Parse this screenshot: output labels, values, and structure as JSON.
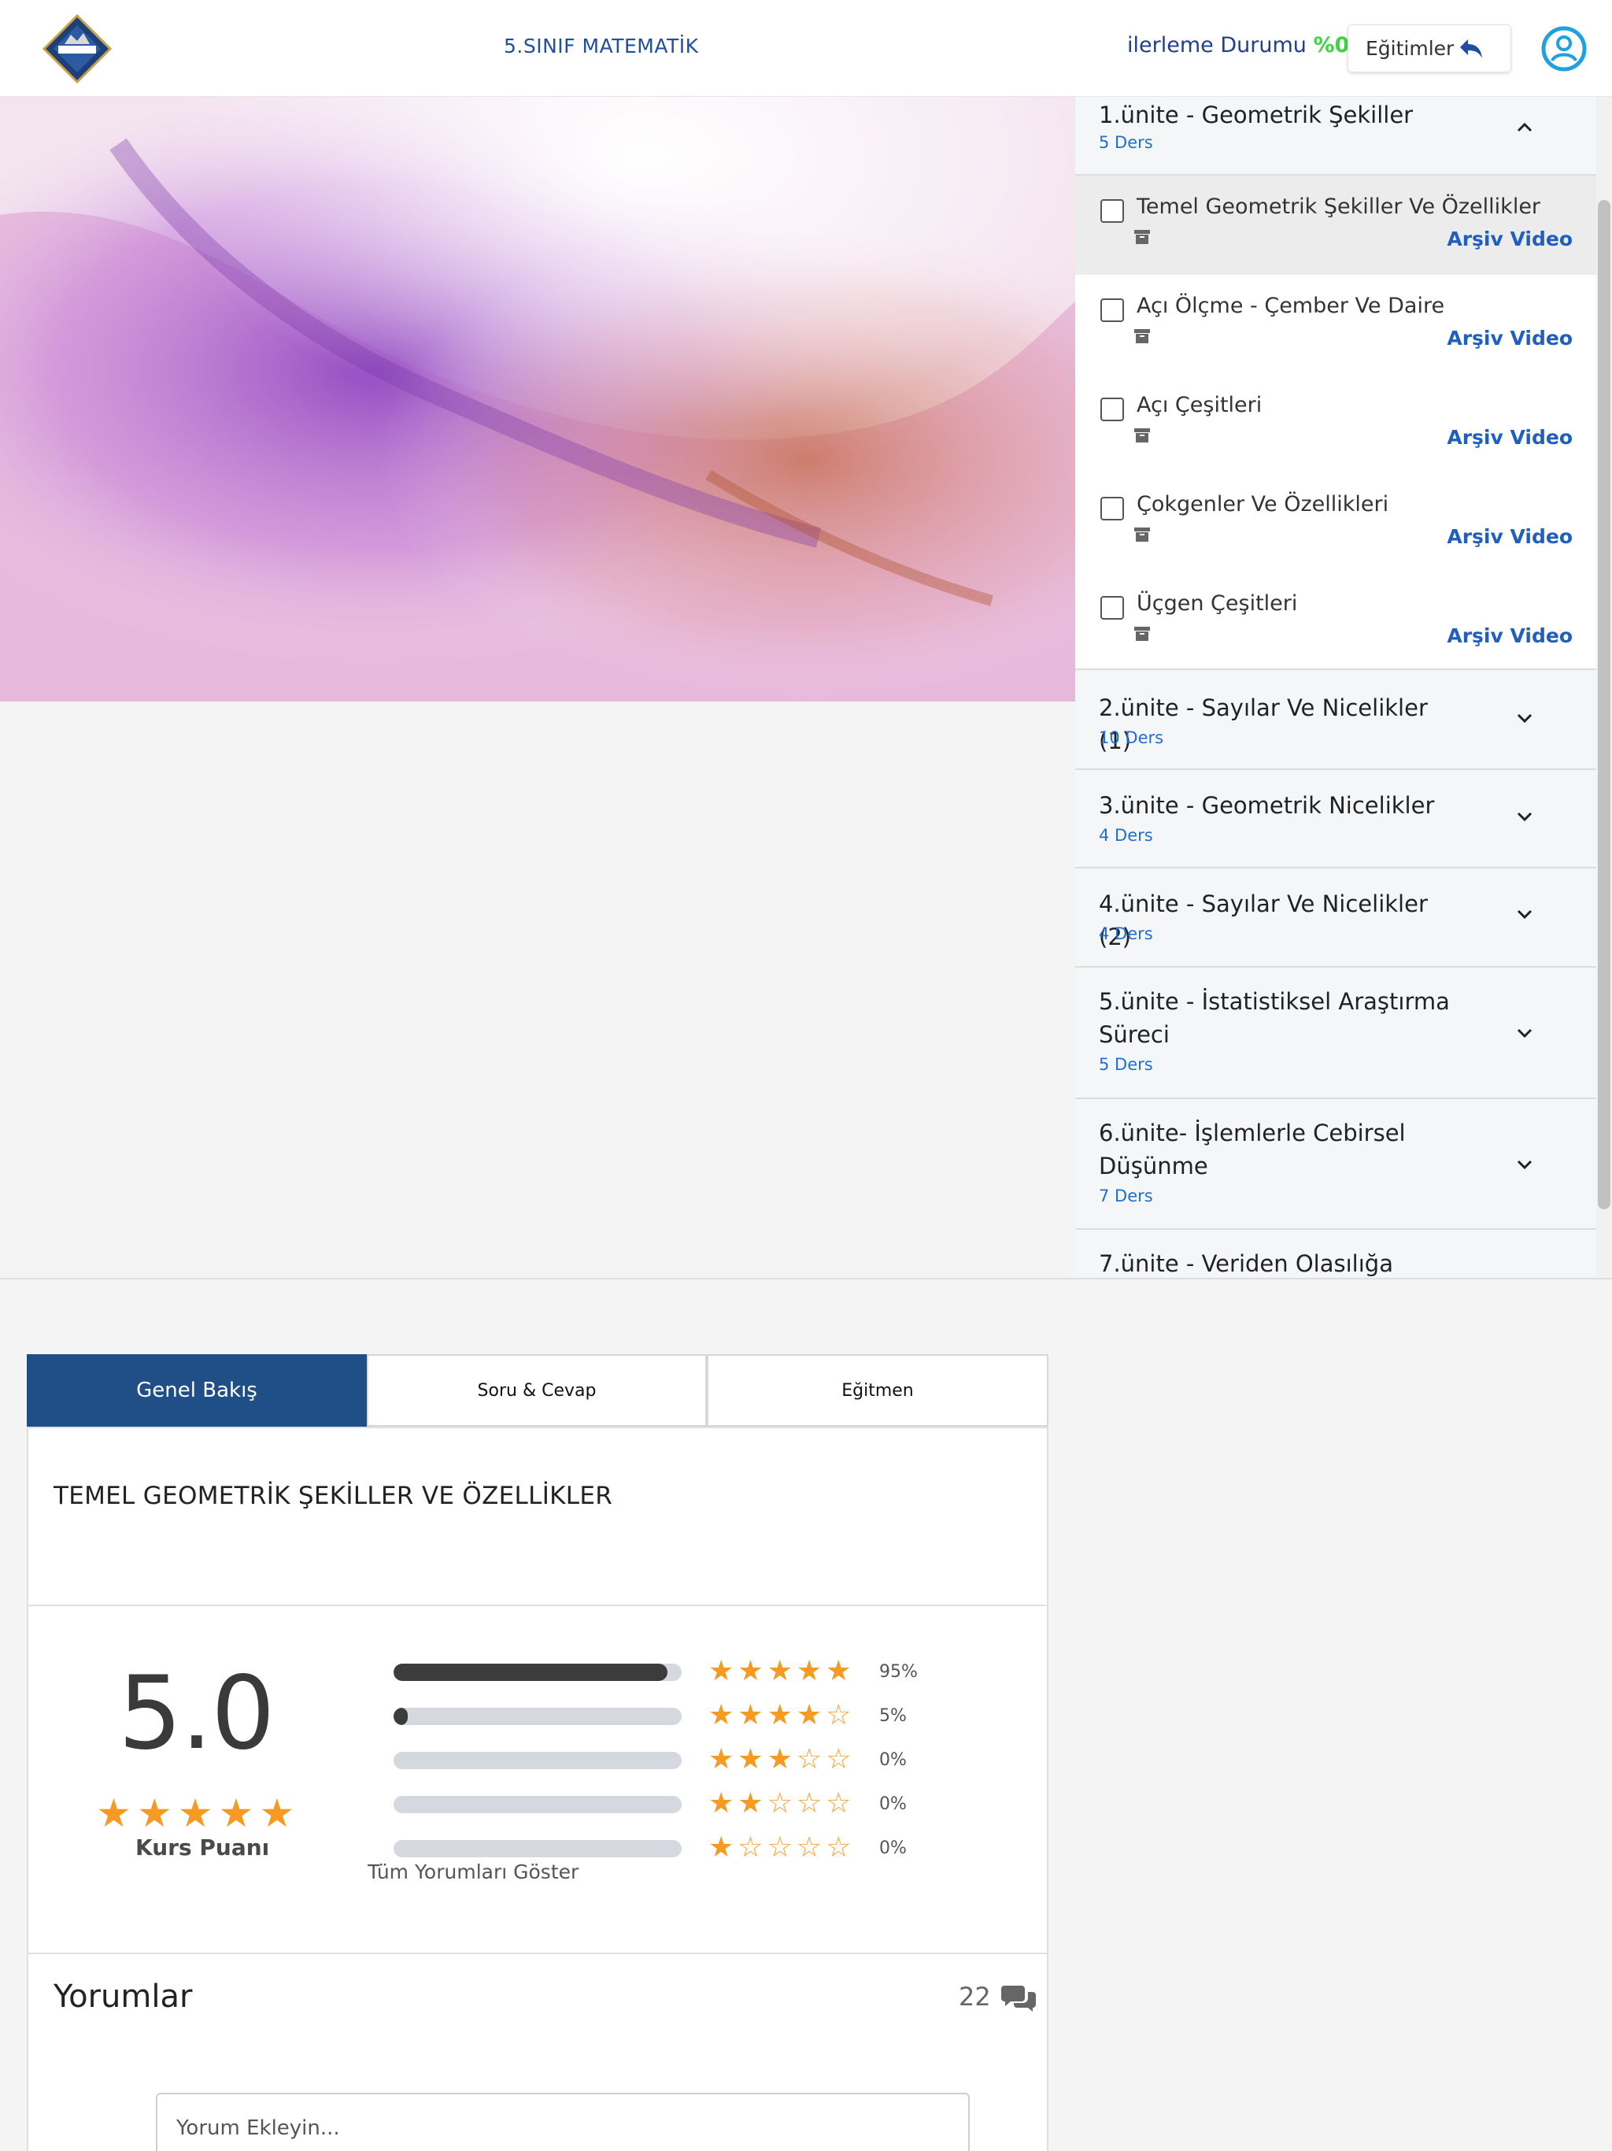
{
  "header": {
    "course_title": "5.SINIF MATEMATİK",
    "progress_label": "ilerleme Durumu",
    "progress_value": "%0",
    "trainings_button": "Eğitimler"
  },
  "units": [
    {
      "title": "1.ünite - Geometrik Şekiller",
      "count": "5 Ders",
      "expanded": true
    },
    {
      "title": "2.ünite - Sayılar Ve Nicelikler (1)",
      "count": "10 Ders"
    },
    {
      "title": "3.ünite - Geometrik Nicelikler",
      "count": "4 Ders"
    },
    {
      "title": "4.ünite - Sayılar Ve Nicelikler (2)",
      "count": "4 Ders"
    },
    {
      "title": "5.ünite - İstatistiksel Araştırma Süreci",
      "count": "5 Ders"
    },
    {
      "title": "6.ünite- İşlemlerle Cebirsel Düşünme",
      "count": "7 Ders"
    },
    {
      "title": "7.ünite - Veriden Olasılığa",
      "count": ""
    }
  ],
  "lessons": [
    {
      "title": "Temel Geometrik Şekiller Ve Özellikler",
      "link": "Arşiv Video",
      "active": true
    },
    {
      "title": "Açı Ölçme - Çember Ve Daire",
      "link": "Arşiv Video"
    },
    {
      "title": "Açı Çeşitleri",
      "link": "Arşiv Video"
    },
    {
      "title": "Çokgenler Ve Özellikleri",
      "link": "Arşiv Video"
    },
    {
      "title": "Üçgen Çeşitleri",
      "link": "Arşiv Video"
    }
  ],
  "tabs": [
    "Genel Bakış",
    "Soru & Cevap",
    "Eğitmen"
  ],
  "lesson_heading": "TEMEL GEOMETRİK ŞEKİLLER VE ÖZELLİKLER",
  "rating": {
    "score": "5.0",
    "label": "Kurs Puanı",
    "rows": [
      {
        "stars": 5,
        "percent": "95%",
        "fraction": 0.95
      },
      {
        "stars": 4,
        "percent": "5%",
        "fraction": 0.05
      },
      {
        "stars": 3,
        "percent": "0%",
        "fraction": 0
      },
      {
        "stars": 2,
        "percent": "0%",
        "fraction": 0
      },
      {
        "stars": 1,
        "percent": "0%",
        "fraction": 0
      }
    ],
    "all_reviews": "Tüm Yorumları Göster"
  },
  "comments": {
    "title": "Yorumlar",
    "count": "22",
    "placeholder": "Yorum Ekleyin..."
  },
  "colors": {
    "primary": "#1f4f86",
    "link": "#1f5fc0",
    "progress_pct": "#3ed63e",
    "star": "#f59a23"
  }
}
